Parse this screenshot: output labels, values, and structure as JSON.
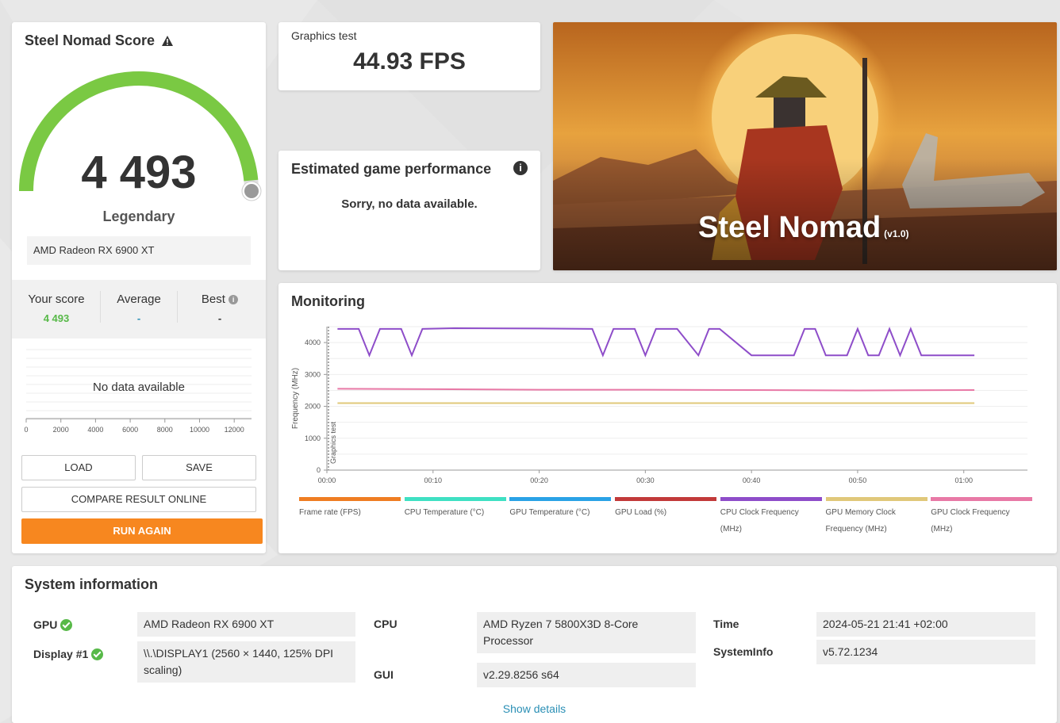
{
  "score": {
    "title": "Steel Nomad Score",
    "value": "4 493",
    "rank": "Legendary",
    "gpu": "AMD Radeon RX 6900 XT",
    "gauge_fraction": 0.97,
    "colors": {
      "gauge": "#7ac943",
      "track": "#e0e0e0"
    }
  },
  "comparison": {
    "your_score_label": "Your score",
    "your_score_value": "4 493",
    "average_label": "Average",
    "average_value": "-",
    "best_label": "Best",
    "best_value": "-",
    "no_data": "No data available",
    "axis_ticks": [
      "0",
      "2000",
      "4000",
      "6000",
      "8000",
      "10000",
      "12000"
    ]
  },
  "buttons": {
    "load": "LOAD",
    "save": "SAVE",
    "compare": "COMPARE RESULT ONLINE",
    "run_again": "RUN AGAIN"
  },
  "graphics_test": {
    "label": "Graphics test",
    "value": "44.93 FPS"
  },
  "estimate": {
    "title": "Estimated game performance",
    "message": "Sorry, no data available."
  },
  "banner": {
    "title": "Steel Nomad",
    "version": "(v1.0)"
  },
  "monitoring": {
    "title": "Monitoring",
    "y_label": "Frequency (MHz)",
    "marker_label": "Graphics test",
    "legend": [
      {
        "label": "Frame rate (FPS)",
        "color": "#ef7d22"
      },
      {
        "label": "CPU Temperature (°C)",
        "color": "#3fe0c3"
      },
      {
        "label": "GPU Temperature (°C)",
        "color": "#2aa2e6"
      },
      {
        "label": "GPU Load (%)",
        "color": "#c23a3a"
      },
      {
        "label": "CPU Clock Frequency (MHz)",
        "color": "#8e4dc9"
      },
      {
        "label": "GPU Memory Clock Frequency (MHz)",
        "color": "#e0c87a"
      },
      {
        "label": "GPU Clock Frequency (MHz)",
        "color": "#e879a6"
      }
    ]
  },
  "chart_data": {
    "type": "line",
    "ylabel": "Frequency (MHz)",
    "ylim": [
      0,
      4500
    ],
    "xlim": [
      0,
      66
    ],
    "y_ticks": [
      0,
      1000,
      2000,
      3000,
      4000
    ],
    "x_tick_labels": [
      "00:00",
      "00:10",
      "00:20",
      "00:30",
      "00:40",
      "00:50",
      "01:00"
    ],
    "x_tick_values": [
      0,
      10,
      20,
      30,
      40,
      50,
      60
    ],
    "grid": true,
    "series": [
      {
        "name": "CPU Clock Frequency (MHz)",
        "color": "#8e4dc9",
        "x": [
          1,
          3,
          4,
          5,
          7,
          8,
          9,
          12,
          20,
          25,
          26,
          27,
          29,
          30,
          31,
          33,
          35,
          36,
          37,
          40,
          41,
          44,
          45,
          46,
          47,
          49,
          50,
          51,
          52,
          53,
          54,
          55,
          56,
          57,
          58,
          59,
          61
        ],
        "y": [
          4430,
          4430,
          3600,
          4430,
          4430,
          3600,
          4430,
          4450,
          4440,
          4430,
          3600,
          4430,
          4430,
          3600,
          4430,
          4430,
          3600,
          4430,
          4430,
          3600,
          3600,
          3600,
          4430,
          4430,
          3600,
          3600,
          4430,
          3600,
          3600,
          4430,
          3600,
          4430,
          3600,
          3600,
          3600,
          3600,
          3600
        ]
      },
      {
        "name": "GPU Clock Frequency (MHz)",
        "color": "#e879a6",
        "x": [
          1,
          10,
          20,
          30,
          40,
          50,
          61
        ],
        "y": [
          2550,
          2540,
          2520,
          2520,
          2510,
          2500,
          2510
        ]
      },
      {
        "name": "GPU Memory Clock Frequency (MHz)",
        "color": "#e0c87a",
        "x": [
          1,
          61
        ],
        "y": [
          2100,
          2100
        ]
      }
    ]
  },
  "system": {
    "title": "System information",
    "gpu_label": "GPU",
    "gpu_value": "AMD Radeon RX 6900 XT",
    "display_label": "Display #1",
    "display_value": "\\\\.\\DISPLAY1 (2560 × 1440, 125% DPI scaling)",
    "cpu_label": "CPU",
    "cpu_value": "AMD Ryzen 7 5800X3D 8-Core Processor",
    "gui_label": "GUI",
    "gui_value": "v2.29.8256 s64",
    "time_label": "Time",
    "time_value": "2024-05-21 21:41 +02:00",
    "sysinfo_label": "SystemInfo",
    "sysinfo_value": "v5.72.1234",
    "show_details": "Show details"
  }
}
